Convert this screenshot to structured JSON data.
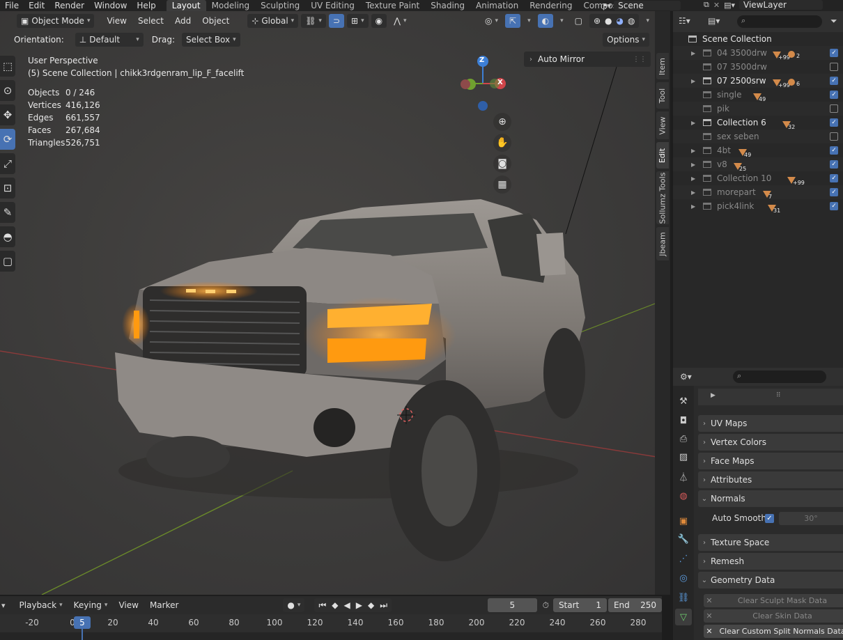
{
  "menu": [
    "File",
    "Edit",
    "Render",
    "Window",
    "Help"
  ],
  "workspaces": [
    "Layout",
    "Modeling",
    "Sculpting",
    "UV Editing",
    "Texture Paint",
    "Shading",
    "Animation",
    "Rendering",
    "Compositing"
  ],
  "active_workspace": "Layout",
  "scene_name": "Scene",
  "view_layer": "ViewLayer",
  "viewport": {
    "mode": "Object Mode",
    "menus": [
      "View",
      "Select",
      "Add",
      "Object"
    ],
    "transform": "Global",
    "orientation_label": "Orientation:",
    "orientation_value": "Default",
    "drag_label": "Drag:",
    "drag_value": "Select Box",
    "options_label": "Options",
    "auto_mirror": "Auto Mirror",
    "view_name": "User Perspective",
    "collection_info": "(5) Scene Collection | chikk3rdgenram_lip_F_facelift",
    "stats": [
      {
        "label": "Objects",
        "value": "0 / 246"
      },
      {
        "label": "Vertices",
        "value": "416,126"
      },
      {
        "label": "Edges",
        "value": "661,557"
      },
      {
        "label": "Faces",
        "value": "267,684"
      },
      {
        "label": "Triangles",
        "value": "526,751"
      }
    ],
    "gizmo": {
      "z": "Z",
      "x": "X"
    },
    "side_tabs": [
      "Item",
      "Tool",
      "View",
      "Edit",
      "Sollumz Tools",
      "Jbeam"
    ]
  },
  "outliner": {
    "root": "Scene Collection",
    "rows": [
      {
        "name": "04 3500drw",
        "dim": true,
        "count1": "+99",
        "count2": "2",
        "checked": true
      },
      {
        "name": "07 3500drw",
        "dim": true,
        "count1": "",
        "count2": "",
        "checked": false
      },
      {
        "name": "07 2500srw",
        "dim": false,
        "count1": "+99",
        "count2": "6",
        "checked": true
      },
      {
        "name": "single",
        "dim": true,
        "count1": "49",
        "count2": "",
        "checked": true
      },
      {
        "name": "pik",
        "dim": true,
        "count1": "",
        "count2": "",
        "checked": false
      },
      {
        "name": "Collection 6",
        "dim": false,
        "count1": "32",
        "count2": "",
        "checked": true
      },
      {
        "name": "sex seben",
        "dim": true,
        "count1": "",
        "count2": "",
        "checked": false
      },
      {
        "name": "4bt",
        "dim": true,
        "count1": "49",
        "count2": "",
        "checked": true
      },
      {
        "name": "v8",
        "dim": true,
        "count1": "25",
        "count2": "",
        "checked": true
      },
      {
        "name": "Collection 10",
        "dim": true,
        "count1": "+99",
        "count2": "",
        "checked": true
      },
      {
        "name": "morepart",
        "dim": true,
        "count1": "7",
        "count2": "",
        "checked": true
      },
      {
        "name": "pick4link",
        "dim": true,
        "count1": "31",
        "count2": "",
        "checked": true
      }
    ]
  },
  "properties": {
    "panels": [
      {
        "label": "UV Maps",
        "open": false
      },
      {
        "label": "Vertex Colors",
        "open": false
      },
      {
        "label": "Face Maps",
        "open": false
      },
      {
        "label": "Attributes",
        "open": false
      },
      {
        "label": "Normals",
        "open": true
      },
      {
        "label": "Texture Space",
        "open": false
      },
      {
        "label": "Remesh",
        "open": false
      },
      {
        "label": "Geometry Data",
        "open": true
      }
    ],
    "auto_smooth_label": "Auto Smooth",
    "auto_smooth_angle": "30°",
    "geometry_buttons": [
      "Clear Sculpt Mask Data",
      "Clear Skin Data",
      "Clear Custom Split Normals Data"
    ]
  },
  "timeline": {
    "menus": [
      "Playback",
      "Keying",
      "View",
      "Marker"
    ],
    "current_frame": "5",
    "start_label": "Start",
    "start": "1",
    "end_label": "End",
    "end": "250",
    "ticks": [
      "-20",
      "0",
      "20",
      "40",
      "60",
      "80",
      "100",
      "120",
      "140",
      "160",
      "180",
      "200",
      "220",
      "240",
      "260",
      "280"
    ]
  }
}
